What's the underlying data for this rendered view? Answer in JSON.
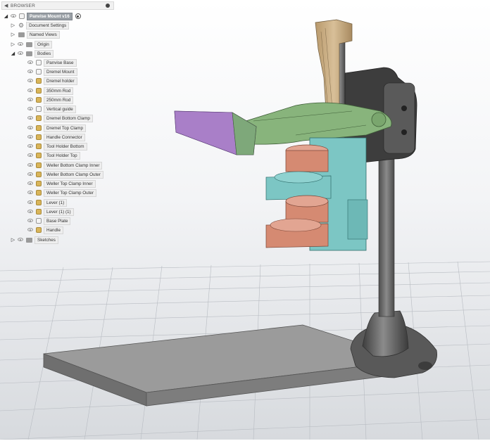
{
  "browser": {
    "title": "BROWSER",
    "root_label": "Panvise Mount v16",
    "items": [
      {
        "label": "Document Settings"
      },
      {
        "label": "Named Views"
      },
      {
        "label": "Origin"
      },
      {
        "label": "Bodies"
      }
    ],
    "bodies": [
      {
        "label": "Panvise Base"
      },
      {
        "label": "Dremel Mount"
      },
      {
        "label": "Dremel holder"
      },
      {
        "label": "350mm Rod"
      },
      {
        "label": "250mm Rod"
      },
      {
        "label": "Vertical guide"
      },
      {
        "label": "Dremel Bottom Clamp"
      },
      {
        "label": "Dremel Top Clamp"
      },
      {
        "label": "Handle Connector"
      },
      {
        "label": "Tool Holder Bottom"
      },
      {
        "label": "Tool Holder Top"
      },
      {
        "label": "Weller Bottom Clamp Inner"
      },
      {
        "label": "Weller Bottom Clamp Outer"
      },
      {
        "label": "Weller Top Clamp Inner"
      },
      {
        "label": "Weller Top Clamp Outer"
      },
      {
        "label": "Lever (1)"
      },
      {
        "label": "Lever (1) (1)"
      },
      {
        "label": "Base Plate"
      },
      {
        "label": "Handle"
      }
    ],
    "sketches_label": "Sketches"
  },
  "colors": {
    "accent": "#9aa0a6",
    "background_top": "#ffffff",
    "grid": "#b8bcc2",
    "base_plate": "#8f8f8f",
    "rod": "#6c6c6c",
    "handle_purple": "#b48ed0",
    "body_green": "#7fae73",
    "tan": "#c9ad86",
    "teal": "#7cc6c4",
    "clamp_red": "#d58a72"
  }
}
